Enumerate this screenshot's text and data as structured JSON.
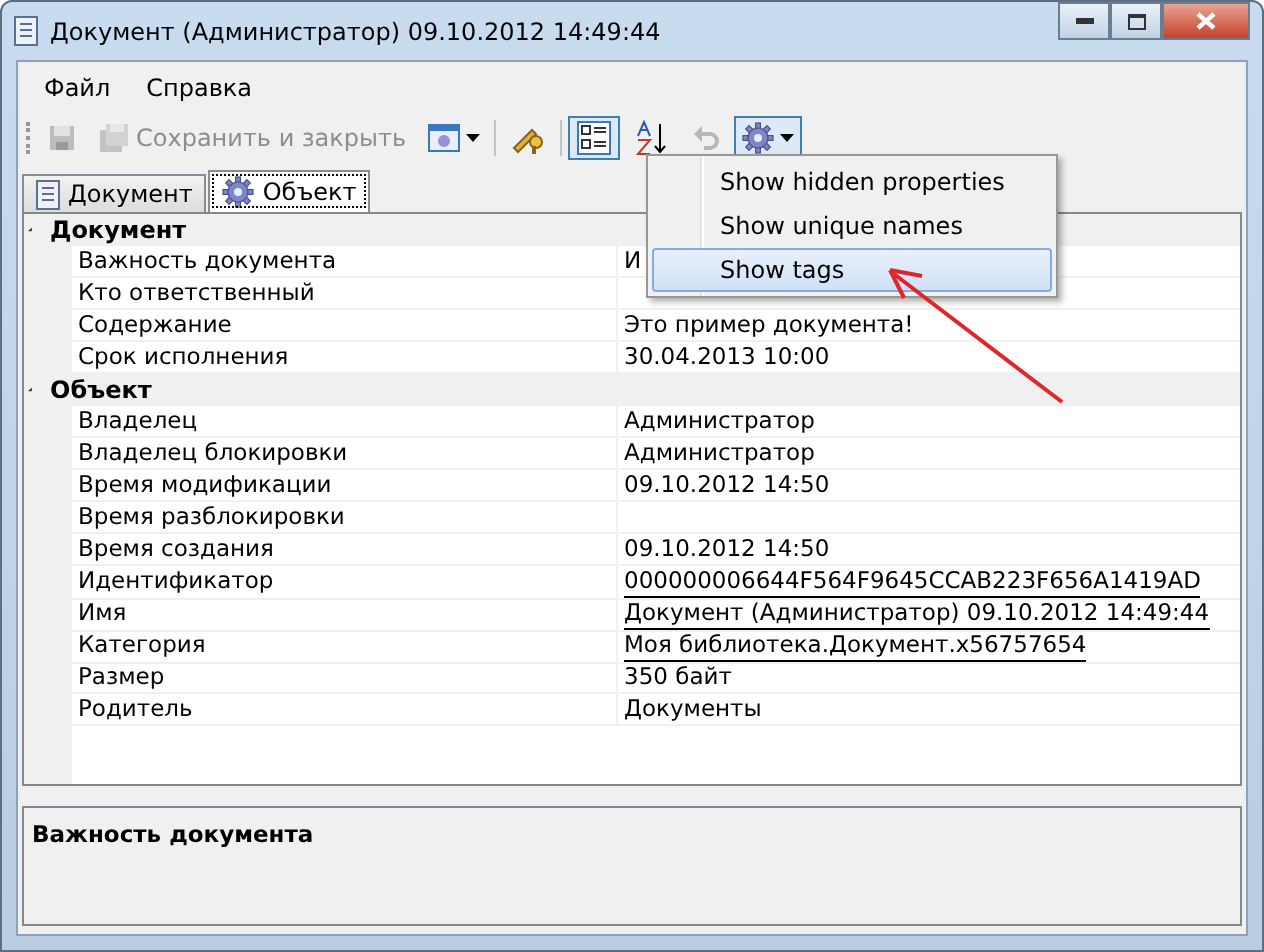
{
  "window": {
    "title": "Документ (Администратор) 09.10.2012 14:49:44"
  },
  "menu": [
    "Файл",
    "Справка"
  ],
  "toolbar": [
    {
      "kind": "save",
      "disabled": true,
      "pressed": false,
      "dropdown": false
    },
    {
      "kind": "save-close",
      "label": "Сохранить и закрыть",
      "disabled": true,
      "pressed": false,
      "dropdown": false
    },
    {
      "kind": "view",
      "disabled": false,
      "pressed": false,
      "dropdown": true
    },
    {
      "kind": "key",
      "disabled": false,
      "pressed": false,
      "dropdown": false
    },
    {
      "kind": "categorized",
      "disabled": false,
      "pressed": true,
      "dropdown": false
    },
    {
      "kind": "sort",
      "disabled": false,
      "pressed": false,
      "dropdown": false
    },
    {
      "kind": "undo",
      "disabled": true,
      "pressed": false,
      "dropdown": false
    },
    {
      "kind": "gear",
      "disabled": false,
      "pressed": true,
      "dropdown": true
    }
  ],
  "tabs": [
    {
      "label": "Документ",
      "kind": "document",
      "selected": false
    },
    {
      "label": "Объект",
      "kind": "gear",
      "selected": true
    }
  ],
  "popup_menu": [
    {
      "label": "Show hidden properties",
      "selected": false
    },
    {
      "label": "Show unique names",
      "selected": false
    },
    {
      "label": "Show tags",
      "selected": true
    }
  ],
  "grid": [
    {
      "category": "Документ",
      "expanded": true,
      "rows": [
        {
          "name": "Важность документа",
          "value": "И",
          "underlined": false
        },
        {
          "name": "Кто ответственный"
        },
        {
          "name": "Содержание",
          "value": "Это пример документа!",
          "underlined": false
        },
        {
          "name": "Срок исполнения",
          "value": "30.04.2013 10:00",
          "underlined": false
        }
      ]
    },
    {
      "category": "Объект",
      "expanded": true,
      "rows": [
        {
          "name": "Владелец",
          "value": "Администратор",
          "underlined": false
        },
        {
          "name": "Владелец блокировки",
          "value": "Администратор",
          "underlined": false
        },
        {
          "name": "Время модификации",
          "value": "09.10.2012 14:50",
          "underlined": false
        },
        {
          "name": "Время разблокировки"
        },
        {
          "name": "Время создания",
          "value": "09.10.2012 14:50",
          "underlined": false
        },
        {
          "name": "Идентификатор",
          "value": "000000006644F564F9645CCAB223F656A1419AD",
          "underlined": true
        },
        {
          "name": "Имя",
          "value": "Документ (Администратор) 09.10.2012 14:49:44",
          "underlined": true
        },
        {
          "name": "Категория",
          "value": "Моя библиотека.Документ.x56757654",
          "underlined": true
        },
        {
          "name": "Размер",
          "value": "350 байт",
          "underlined": false
        },
        {
          "name": "Родитель",
          "value": "Документы",
          "underlined": false
        }
      ]
    }
  ],
  "description": {
    "title": "Важность документа"
  }
}
